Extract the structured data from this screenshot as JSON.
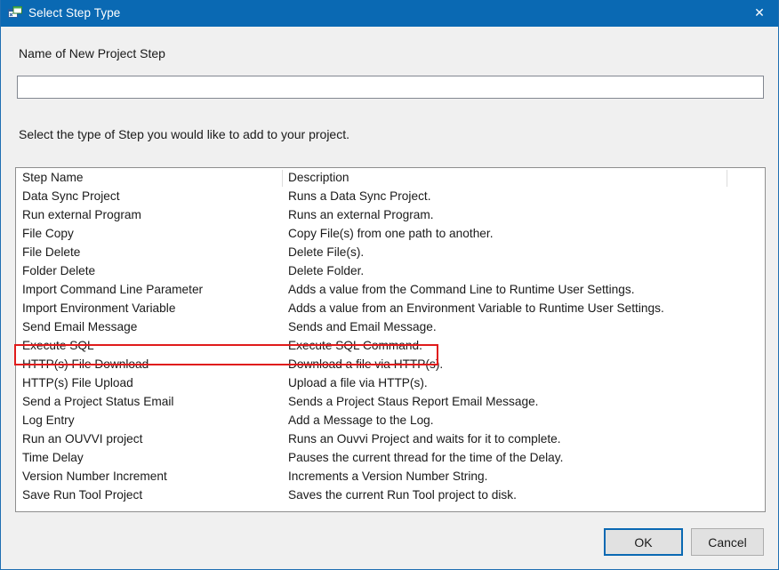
{
  "window": {
    "title": "Select Step Type",
    "icon": "app-window-icon",
    "close_label": "✕",
    "titlebar_color": "#0a69b3",
    "border_color": "#1f6fb2",
    "background_color": "#f0f0f0"
  },
  "form": {
    "name_label": "Name of New Project Step",
    "name_value": "",
    "name_placeholder": "",
    "instruction_label": "Select the type of Step you would like to add to your project."
  },
  "list": {
    "columns": [
      "Step Name",
      "Description"
    ],
    "rows": [
      {
        "name": "Data Sync Project",
        "description": "Runs a Data Sync Project."
      },
      {
        "name": "Run external Program",
        "description": "Runs an external Program."
      },
      {
        "name": "File Copy",
        "description": "Copy File(s) from one path to another."
      },
      {
        "name": "File Delete",
        "description": "Delete File(s)."
      },
      {
        "name": "Folder Delete",
        "description": "Delete Folder."
      },
      {
        "name": "Import Command Line Parameter",
        "description": "Adds a value from the Command Line to Runtime User Settings."
      },
      {
        "name": "Import Environment Variable",
        "description": "Adds a value from an Environment Variable to Runtime User Settings."
      },
      {
        "name": "Send Email Message",
        "description": "Sends and Email Message."
      },
      {
        "name": "Execute SQL",
        "description": "Execute SQL Command."
      },
      {
        "name": "HTTP(s) File Download",
        "description": "Download a file via HTTP(s)."
      },
      {
        "name": "HTTP(s) File Upload",
        "description": "Upload a file via HTTP(s)."
      },
      {
        "name": "Send a Project Status Email",
        "description": "Sends a Project Staus Report Email Message."
      },
      {
        "name": "Log Entry",
        "description": "Add a Message to the Log."
      },
      {
        "name": "Run an OUVVI project",
        "description": "Runs an Ouvvi Project and waits for it to complete."
      },
      {
        "name": "Time Delay",
        "description": "Pauses the current thread for the time of the Delay."
      },
      {
        "name": "Version Number Increment",
        "description": "Increments a Version Number String."
      },
      {
        "name": "Save Run Tool Project",
        "description": "Saves the current Run Tool project to disk."
      }
    ],
    "highlighted_row_name": "Send Email Message",
    "highlight_color": "#e01b1b"
  },
  "buttons": {
    "ok_label": "OK",
    "cancel_label": "Cancel",
    "focus_color": "#0a69b3"
  }
}
